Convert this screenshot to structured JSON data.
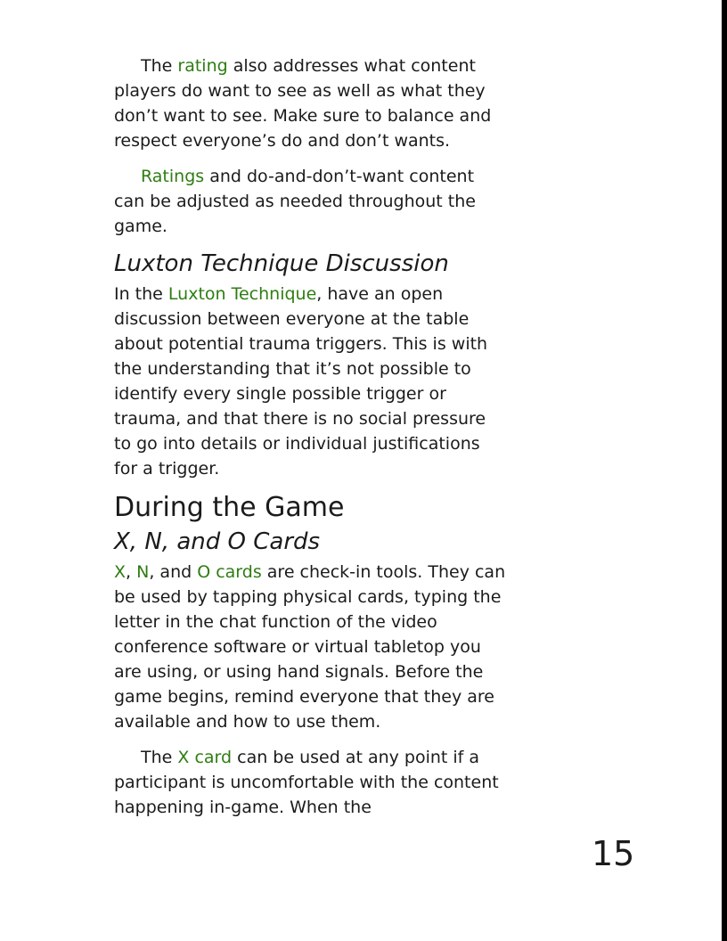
{
  "p1": {
    "pre": "The ",
    "kw1": "rating",
    "post": " also addresses what content players do want to see as well as what they don’t want to see. Make sure to balance and respect everyone’s do and don’t wants."
  },
  "p2": {
    "kw1": "Ratings",
    "post": " and do-and-don’t-want content can be adjusted as needed throughout the game."
  },
  "luxton": {
    "heading": "Luxton Technique Discussion",
    "pre": "In the ",
    "kw1": "Luxton Technique",
    "post": ", have an open discussion between everyone at the table about potential trauma triggers. This is with the understanding that it’s not possible to identify every single possible trigger or trauma, and that there is no social pressure to go into details or individual justifications for a trigger."
  },
  "section": {
    "heading": "During the Game"
  },
  "cards": {
    "heading": "X, N, and O Cards",
    "kw_x": "X",
    "sep1": ", ",
    "kw_n": "N",
    "sep2": ", and ",
    "kw_o": "O cards",
    "post": " are check-in tools. They can be used by tapping physical cards, typing the letter in the chat function of the video conference software or virtual tabletop you are using, or using hand signals. Before the game begins, remind everyone that they are available and how to use them."
  },
  "xcard": {
    "pre": "The ",
    "kw1": "X card",
    "post": " can be used at any point if a participant is uncomfortable with the content happening in-game. When the"
  },
  "page_number": "15",
  "colors": {
    "keyword": "#2e7d12",
    "text": "#1b1b1b"
  }
}
